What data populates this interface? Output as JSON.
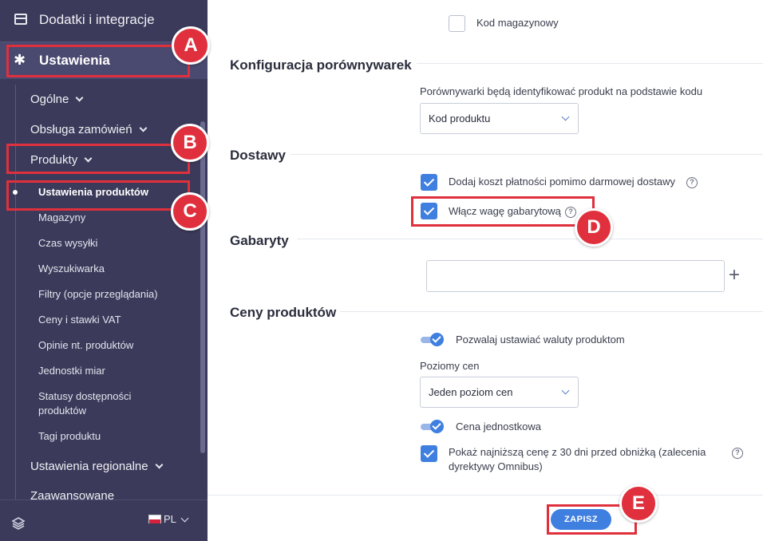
{
  "sidebar": {
    "top_item": "Dodatki i integracje",
    "settings": "Ustawienia",
    "items": {
      "general": "Ogólne",
      "orders": "Obsługa zamówień",
      "products": "Produkty",
      "regional": "Ustawienia regionalne",
      "advanced_cut": "Zaawansowane"
    },
    "product_sub": [
      "Ustawienia produktów",
      "Magazyny",
      "Czas wysyłki",
      "Wyszukiwarka",
      "Filtry (opcje przeglądania)",
      "Ceny i stawki VAT",
      "Opinie nt. produktów",
      "Jednostki miar",
      "Statusy dostępności",
      "produktów",
      "Tagi produktu"
    ],
    "language": "PL"
  },
  "main": {
    "warehouse_code_label": "Kod magazynowy",
    "comparators": {
      "title": "Konfiguracja porównywarek",
      "field_label": "Porównywarki będą identyfikować produkt na podstawie kodu",
      "select_value": "Kod produktu"
    },
    "deliveries": {
      "title": "Dostawy",
      "payment_cost_label": "Dodaj koszt płatności pomimo darmowej dostawy",
      "dim_weight_label": "Włącz wagę gabarytową"
    },
    "dimensions": {
      "title": "Gabaryty",
      "input_value": ""
    },
    "prices": {
      "title": "Ceny produktów",
      "currency_toggle_label": "Pozwalaj ustawiać waluty produktom",
      "levels_label": "Poziomy cen",
      "levels_value": "Jeden poziom cen",
      "unit_price_label": "Cena jednostkowa",
      "lowest_price_label_1": "Pokaż najniższą cenę z 30 dni przed obniżką (zalecenia",
      "lowest_price_label_2": "dyrektywy Omnibus)"
    },
    "save_label": "ZAPISZ"
  },
  "annotations": [
    "A",
    "B",
    "C",
    "D",
    "E"
  ],
  "colors": {
    "sidebar_bg": "#3b3a5a",
    "accent": "#3f7fe0",
    "annotation": "#e0303d"
  }
}
